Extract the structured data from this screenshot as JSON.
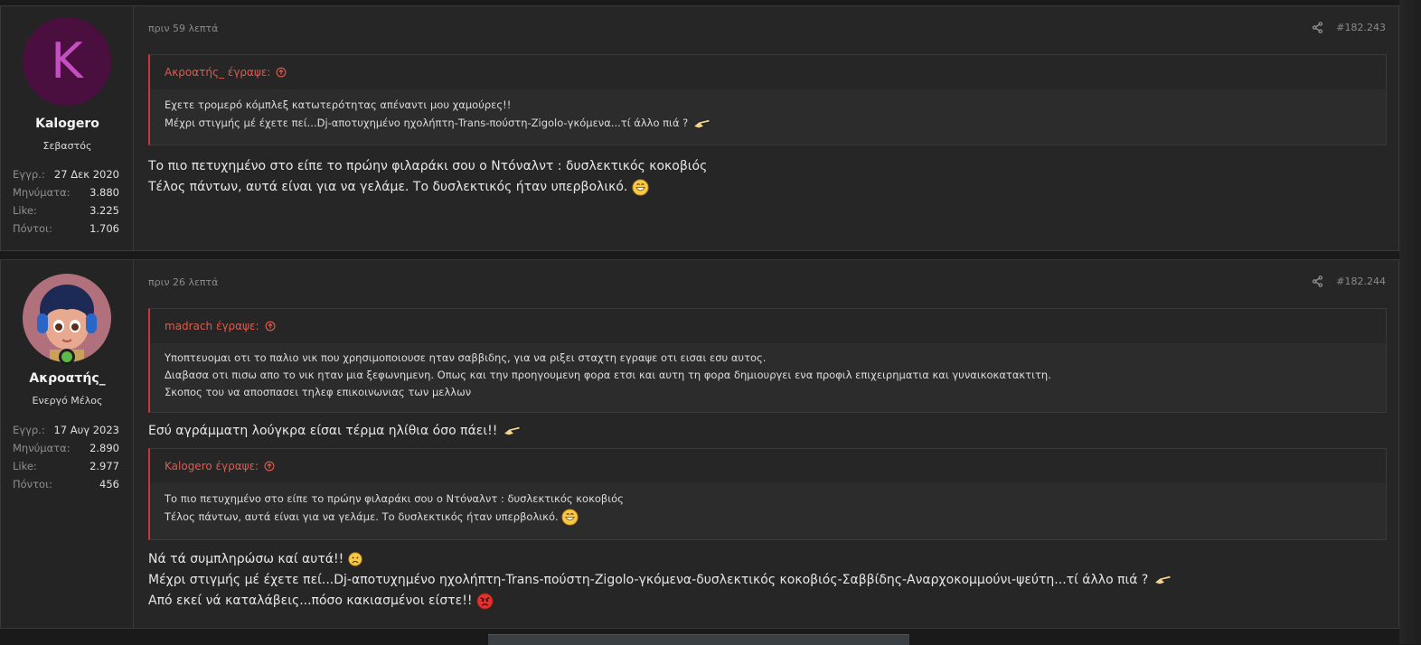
{
  "posts": [
    {
      "user": {
        "avatar_letter": "K",
        "name": "Kalogero",
        "title": "Σεβαστός",
        "stats": [
          {
            "label": "Εγγρ.:",
            "value": "27 Δεκ 2020"
          },
          {
            "label": "Μηνύματα:",
            "value": "3.880"
          },
          {
            "label": "Like:",
            "value": "3.225"
          },
          {
            "label": "Πόντοι:",
            "value": "1.706"
          }
        ]
      },
      "time": "πριν 59 λεπτά",
      "post_number": "#182.243",
      "quote": {
        "author": "Ακροατής_ έγραψε:",
        "lines": [
          "Εχετε τρομερό κόμπλεξ κατωτερότητας απέναντι μου χαμούρες!!",
          "Μέχρι στιγμής μέ έχετε πεί...Dj-αποτυχημένο ηχολήπτη-Trans-πούστη-Zigolo-γκόμενα...τί άλλο πιά ?"
        ]
      },
      "message": [
        "Το πιο πετυχημένο στο είπε το πρώην φιλαράκι σου ο Ντόναλντ : δυσλεκτικός κοκοβιός",
        "Τέλος πάντων, αυτά είναι για να γελάμε. Το δυσλεκτικός ήταν υπερβολικό."
      ]
    },
    {
      "user": {
        "name": "Ακροατής_",
        "title": "Ενεργό Μέλος",
        "stats": [
          {
            "label": "Εγγρ.:",
            "value": "17 Αυγ 2023"
          },
          {
            "label": "Μηνύματα:",
            "value": "2.890"
          },
          {
            "label": "Like:",
            "value": "2.977"
          },
          {
            "label": "Πόντοι:",
            "value": "456"
          }
        ]
      },
      "time": "πριν 26 λεπτά",
      "post_number": "#182.244",
      "quote1": {
        "author": "madrach έγραψε:",
        "lines": [
          "Υποπτευομαι οτι το παλιο νικ που χρησιμοποιουσε ηταν σαββιδης, για να ριξει σταχτη εγραψε οτι εισαι εσυ αυτος.",
          "Διαβασα οτι πισω απο το νικ ηταν μια ξεφωνημενη. Οπως και την προηγουμενη φορα ετσι και αυτη τη φορα δημιουργει ενα προφιλ επιχειρηματια και γυναικοκατακτιτη.",
          "Σκοπος του να αποσπασει τηλεφ επικοινωνιας των μελλων"
        ]
      },
      "reply1": "Εσύ αγράμματη λούγκρα είσαι τέρμα ηλίθια όσο πάει!!",
      "quote2": {
        "author": "Kalogero έγραψε:",
        "lines": [
          "Το πιο πετυχημένο στο είπε το πρώην φιλαράκι σου ο Ντόναλντ : δυσλεκτικός κοκοβιός",
          "Τέλος πάντων, αυτά είναι για να γελάμε. Το δυσλεκτικός ήταν υπερβολικό."
        ]
      },
      "reply2": [
        "Νά τά συμπληρώσω καί αυτά!!",
        "Μέχρι στιγμής μέ έχετε πεί...Dj-αποτυχημένο ηχολήπτη-Trans-πούστη-Zigolo-γκόμενα-δυσλεκτικός κοκοβιός-Σαββίδης-Αναρχοκομμούνι-ψεύτη...τί άλλο πιά ?",
        "Από εκεί νά καταλάβεις...πόσο κακιασμένοι είστε!!"
      ]
    }
  ]
}
